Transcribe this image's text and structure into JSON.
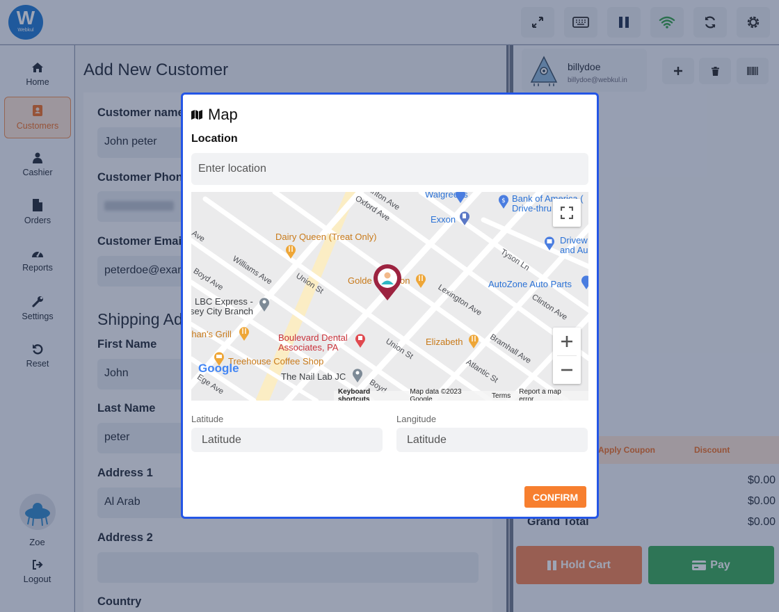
{
  "topbar": {
    "logo_letter": "W",
    "logo_text": "Webkul"
  },
  "sidebar": {
    "items": [
      {
        "label": "Home"
      },
      {
        "label": "Customers"
      },
      {
        "label": "Cashier"
      },
      {
        "label": "Orders"
      },
      {
        "label": "Reports"
      },
      {
        "label": "Settings"
      },
      {
        "label": "Reset"
      }
    ],
    "user_name": "Zoe",
    "logout_label": "Logout"
  },
  "main": {
    "title": "Add New Customer",
    "customer_name_label": "Customer name",
    "customer_name_value": "John peter",
    "customer_phone_label": "Customer Phone",
    "customer_email_label": "Customer Email",
    "customer_email_value": "peterdoe@example.com",
    "shipping_title": "Shipping Address",
    "first_name_label": "First Name",
    "first_name_value": "John",
    "last_name_label": "Last Name",
    "last_name_value": "peter",
    "address1_label": "Address 1",
    "address1_value": "Al Arab",
    "address2_label": "Address 2",
    "country_label": "Country"
  },
  "cart": {
    "customer_name": "billydoe",
    "customer_email": "billydoe@webkul.in",
    "apply_coupon": "Apply Coupon",
    "discount": "Discount",
    "row1_value": "$0.00",
    "row2_value": "$0.00",
    "grand_total_label": "Grand Total",
    "grand_total_value": "$0.00",
    "hold_cart_label": "Hold Cart",
    "pay_label": "Pay"
  },
  "modal": {
    "title": "Map",
    "location_label": "Location",
    "location_placeholder": "Enter location",
    "latitude_label": "Latitude",
    "latitude_placeholder": "Latitude",
    "longitude_label": "Langitude",
    "longitude_placeholder": "Latitude",
    "confirm_label": "CONFIRM"
  },
  "map": {
    "places": {
      "walgreens": "Walgreens",
      "bank_of_america_1": "Bank of America (",
      "bank_of_america_2": "Drive-thru",
      "exxon": "Exxon",
      "dairy_queen": "Dairy Queen (Treat Only)",
      "driveway_1": "Drivew",
      "driveway_2": "and Au",
      "golden_1": "Golde",
      "golden_2": "on",
      "autozone": "AutoZone Auto Parts",
      "lbc_1": "LBC Express -",
      "lbc_2": "sey City Branch",
      "grill": "rhan's Grill",
      "boulevard_1": "Boulevard Dental",
      "boulevard_2": "Associates, PA",
      "elizabeth": "Elizabeth",
      "treehouse": "Treehouse Coffee Shop",
      "nail_lab": "The Nail Lab JC"
    },
    "streets": {
      "clinton_1": "Clinton Ave",
      "oxford": "Oxford Ave",
      "ave_left": "Ave",
      "williams": "Williams Ave",
      "union_1": "Union St",
      "boyd_1": "Boyd Ave",
      "tyson": "Tyson Ln",
      "lexington": "Lexington Ave",
      "clinton_2": "Clinton Ave",
      "bramhall": "Bramhall Ave",
      "union_2": "Union St",
      "atlantic": "Atlantic St",
      "edge": "Ege Ave",
      "boyd_2": "Boyd"
    },
    "google_logo": "Google",
    "attribution": {
      "shortcuts": "Keyboard shortcuts",
      "map_data": "Map data ©2023 Google",
      "terms": "Terms",
      "report": "Report a map error"
    }
  }
}
